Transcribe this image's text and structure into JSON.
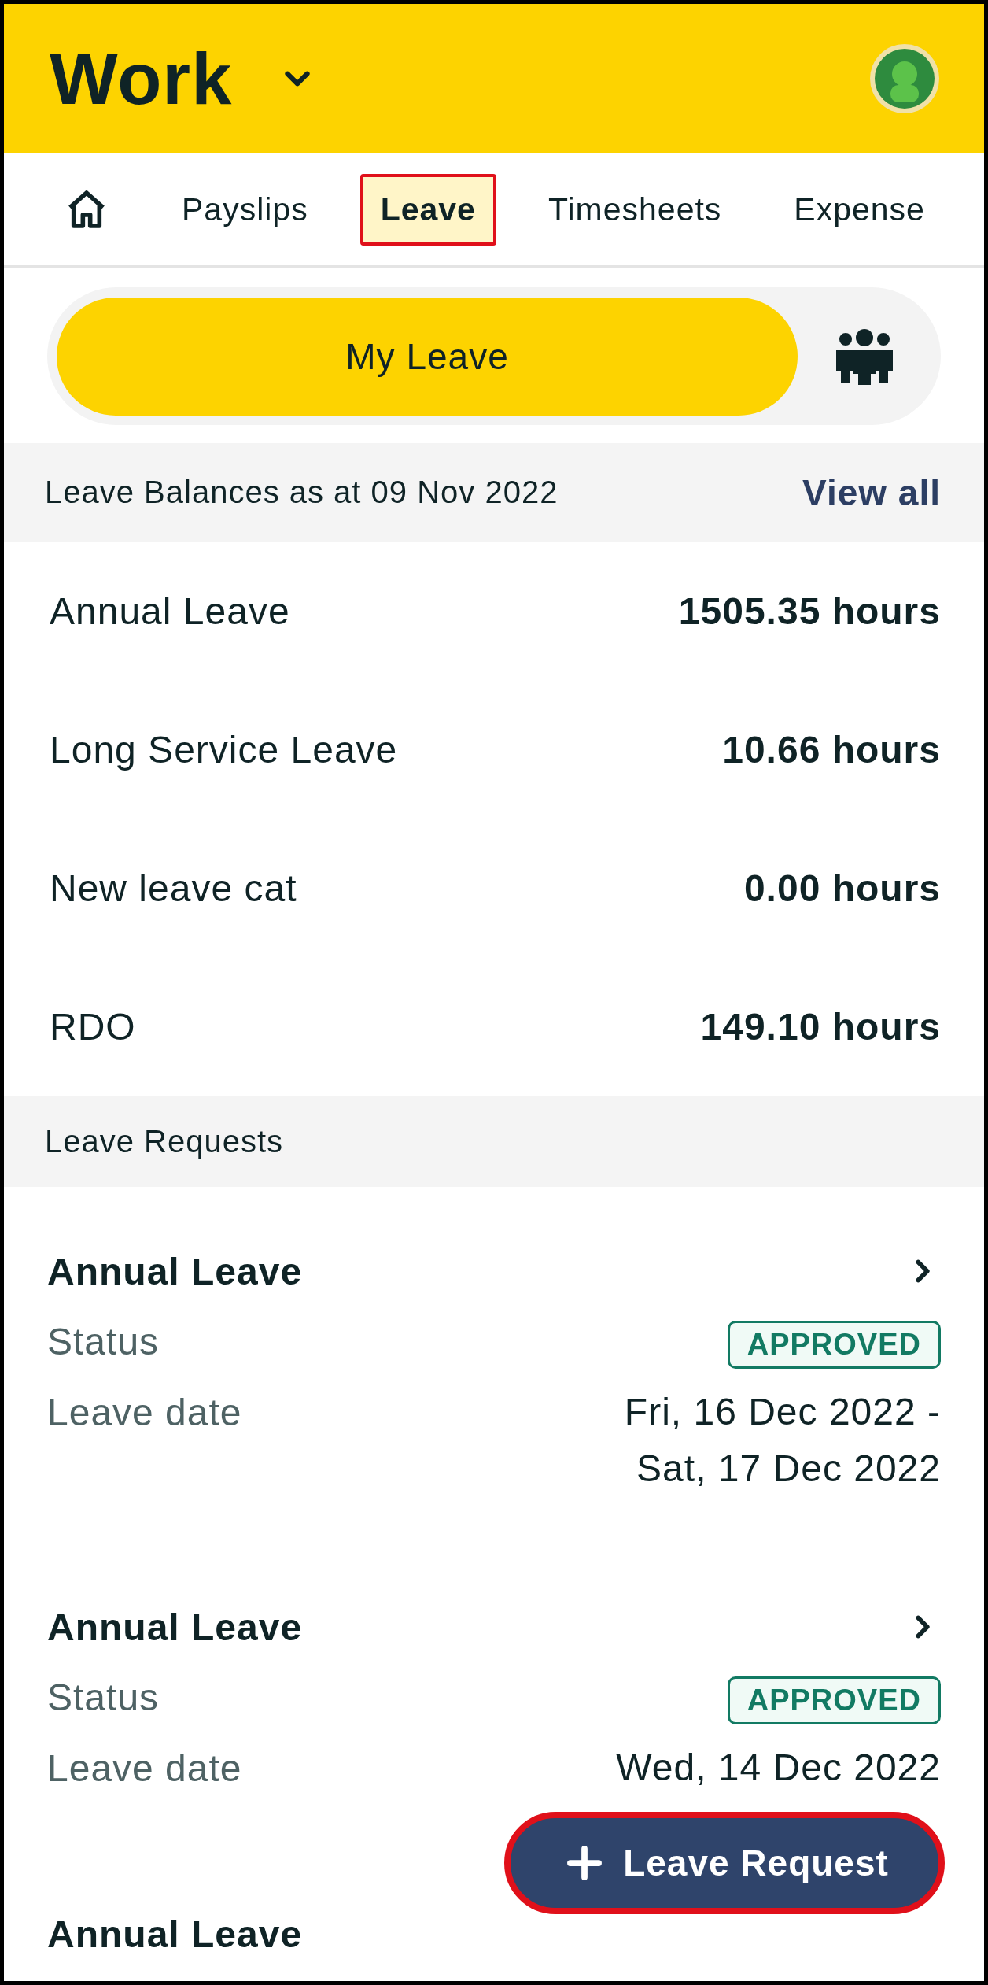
{
  "header": {
    "title": "Work"
  },
  "tabs": [
    {
      "kind": "home",
      "selected": false,
      "highlighted": false
    },
    {
      "kind": "text",
      "label": "Payslips",
      "selected": false,
      "highlighted": false
    },
    {
      "kind": "text",
      "label": "Leave",
      "selected": true,
      "highlighted": true
    },
    {
      "kind": "text",
      "label": "Timesheets",
      "selected": false,
      "highlighted": false
    },
    {
      "kind": "text",
      "label": "Expense",
      "selected": false,
      "highlighted": false
    }
  ],
  "segments": [
    {
      "kind": "text",
      "label": "My Leave",
      "selected": true
    },
    {
      "kind": "team",
      "selected": false
    }
  ],
  "balances": {
    "heading": "Leave Balances as at 09 Nov 2022",
    "link": "View all",
    "rows": [
      {
        "name": "Annual Leave",
        "value": "1505.35 hours"
      },
      {
        "name": "Long Service Leave",
        "value": "10.66 hours"
      },
      {
        "name": "New leave cat",
        "value": "0.00 hours"
      },
      {
        "name": "RDO",
        "value": "149.10 hours"
      }
    ]
  },
  "requests": {
    "heading": "Leave Requests",
    "items": [
      {
        "title": "Annual Leave",
        "status_label": "Status",
        "status": "APPROVED",
        "date_label": "Leave date",
        "dates": [
          "Fri, 16 Dec 2022 -",
          "Sat, 17 Dec 2022"
        ]
      },
      {
        "title": "Annual Leave",
        "status_label": "Status",
        "status": "APPROVED",
        "date_label": "Leave date",
        "dates": [
          "Wed, 14 Dec 2022"
        ]
      },
      {
        "title": "Annual Leave"
      }
    ]
  },
  "fab": {
    "label": "Leave Request",
    "highlighted": true
  }
}
